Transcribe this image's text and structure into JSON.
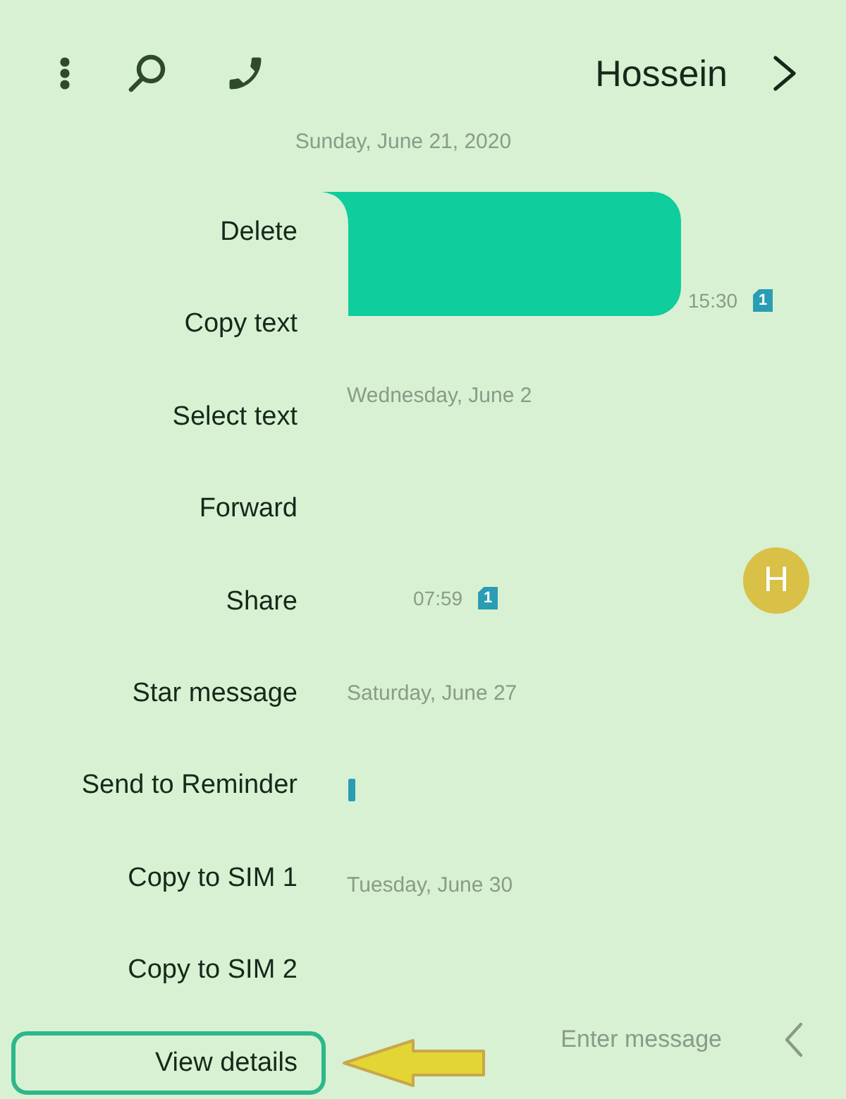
{
  "header": {
    "title": "Hossein"
  },
  "date_header": "Sunday, June 21, 2020",
  "messages": [
    {
      "kind": "sent",
      "time": "15:30",
      "sim": "1"
    },
    {
      "kind": "date",
      "text": "Wednesday, June 2"
    },
    {
      "kind": "received",
      "time": "07:59",
      "sim": "1",
      "avatar_initial": "H"
    },
    {
      "kind": "date",
      "text": "Saturday, June 27"
    },
    {
      "kind": "sim_fragment"
    },
    {
      "kind": "date",
      "text": "Tuesday, June 30"
    }
  ],
  "context_menu": {
    "items": [
      {
        "label": "Delete",
        "highlighted": false
      },
      {
        "label": "Copy text",
        "highlighted": false
      },
      {
        "label": "Select text",
        "highlighted": false
      },
      {
        "label": "Forward",
        "highlighted": false
      },
      {
        "label": "Share",
        "highlighted": false
      },
      {
        "label": "Star message",
        "highlighted": false
      },
      {
        "label": "Send to Reminder",
        "highlighted": false
      },
      {
        "label": "Copy to SIM 1",
        "highlighted": false
      },
      {
        "label": "Copy to SIM 2",
        "highlighted": false
      },
      {
        "label": "View details",
        "highlighted": true
      }
    ]
  },
  "composer": {
    "placeholder": "Enter message"
  }
}
